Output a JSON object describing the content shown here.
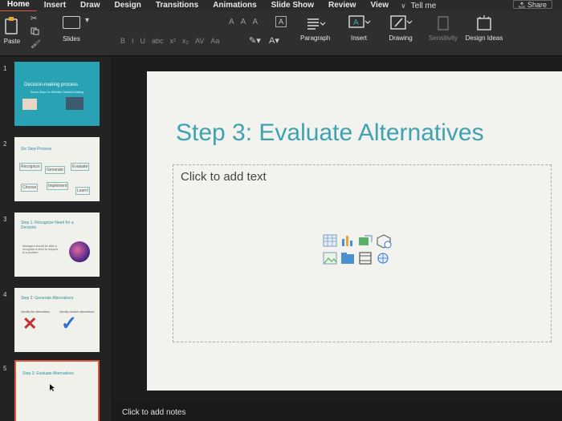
{
  "menu": {
    "items": [
      "Home",
      "Insert",
      "Draw",
      "Design",
      "Transitions",
      "Animations",
      "Slide Show",
      "Review",
      "View"
    ],
    "tell_me": "Tell me",
    "share": "Share"
  },
  "ribbon": {
    "paste": "Paste",
    "slides": "Slides",
    "paragraph": "Paragraph",
    "insert": "Insert",
    "drawing": "Drawing",
    "sensitivity": "Sensitivity",
    "design_ideas": "Design Ideas",
    "font_buttons": [
      "B",
      "I",
      "U",
      "abc",
      "x²",
      "x₂",
      "AV",
      "Aa"
    ],
    "font_size_buttons": [
      "A",
      "A",
      "A"
    ]
  },
  "slides": [
    {
      "number": "1",
      "title": "Decision-making process",
      "subtitle": "Seven Steps for Effective Decision-Making"
    },
    {
      "number": "2",
      "title": "Six Step Process",
      "boxes": [
        "Recognize",
        "Generate",
        "Evaluate",
        "Choose",
        "Implement",
        "Learn!"
      ]
    },
    {
      "number": "3",
      "title": "Step 1: Recognize Need for a Decision",
      "body": "Managers should be able to recognize a need to respond to a problem."
    },
    {
      "number": "4",
      "title": "Step 2: Generate Alternatives",
      "body_left": "Identify the alternatives",
      "body_right": "Identify creative alternatives"
    },
    {
      "number": "5",
      "title": "Step 3: Evaluate Alternatives"
    }
  ],
  "current_slide": {
    "title": "Step 3: Evaluate Alternatives",
    "placeholder": "Click to add text"
  },
  "notes": {
    "placeholder": "Click to add notes"
  },
  "colors": {
    "accent": "#3fa2b0",
    "menu_active": "#d9563a",
    "thumb1_bg": "#29a3b3"
  }
}
